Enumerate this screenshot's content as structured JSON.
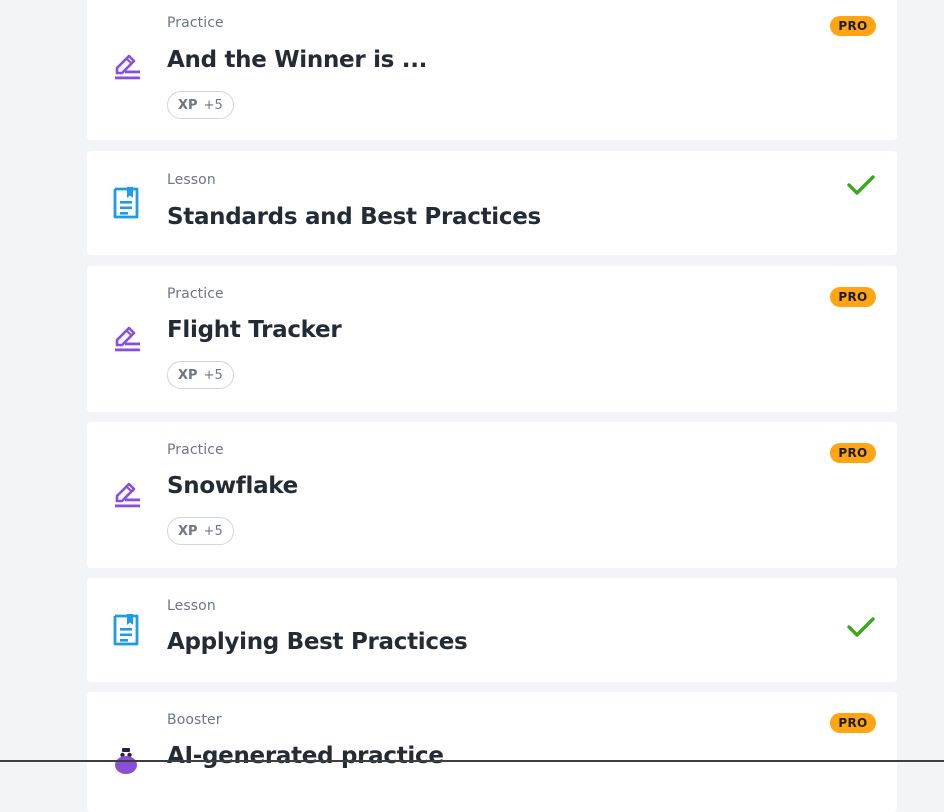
{
  "colors": {
    "background": "#f2f5f7",
    "card": "#ffffff",
    "practice_icon": "#8a4fd8",
    "lesson_icon": "#1e9be6",
    "pro_badge": "#ffa412",
    "check": "#3aa81d"
  },
  "items": [
    {
      "type": "Practice",
      "title": "And the Winner is ...",
      "icon": "pencil-icon",
      "pro_badge": "PRO",
      "xp_label": "XP",
      "xp_value": "+5"
    },
    {
      "type": "Lesson",
      "title": "Standards and Best Practices",
      "icon": "lesson-document-icon",
      "status": "completed"
    },
    {
      "type": "Practice",
      "title": "Flight Tracker",
      "icon": "pencil-icon",
      "pro_badge": "PRO",
      "xp_label": "XP",
      "xp_value": "+5"
    },
    {
      "type": "Practice",
      "title": "Snowflake",
      "icon": "pencil-icon",
      "pro_badge": "PRO",
      "xp_label": "XP",
      "xp_value": "+5"
    },
    {
      "type": "Lesson",
      "title": "Applying Best Practices",
      "icon": "lesson-document-icon",
      "status": "completed"
    },
    {
      "type": "Booster",
      "title": "AI-generated practice",
      "icon": "robot-icon",
      "pro_badge": "PRO"
    }
  ]
}
